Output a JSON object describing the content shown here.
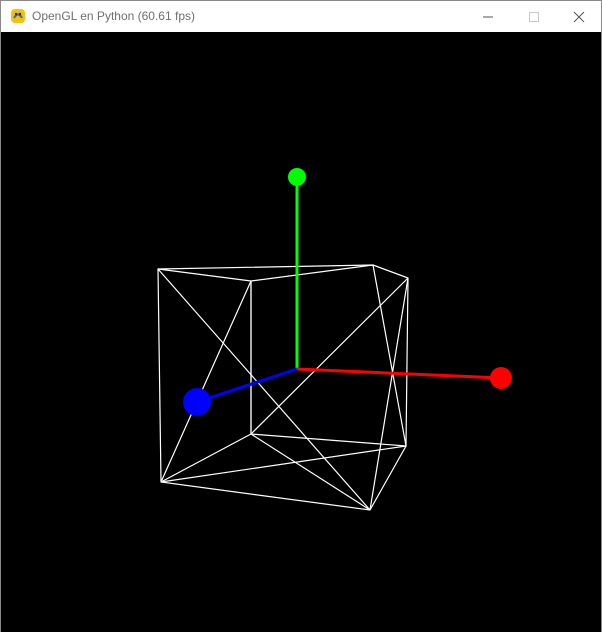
{
  "window": {
    "title": "OpenGL en Python (60.61 fps)",
    "icon": "pygame-snake-icon"
  },
  "controls": {
    "minimize_icon": "minimize-icon",
    "maximize_icon": "maximize-icon",
    "close_icon": "close-icon"
  },
  "scene": {
    "background": "#000000",
    "wireframe_color": "#ffffff",
    "axes": [
      {
        "name": "x-axis",
        "color": "#ff0000"
      },
      {
        "name": "y-axis",
        "color": "#00ff00"
      },
      {
        "name": "z-axis",
        "color": "#0000ff"
      }
    ]
  }
}
